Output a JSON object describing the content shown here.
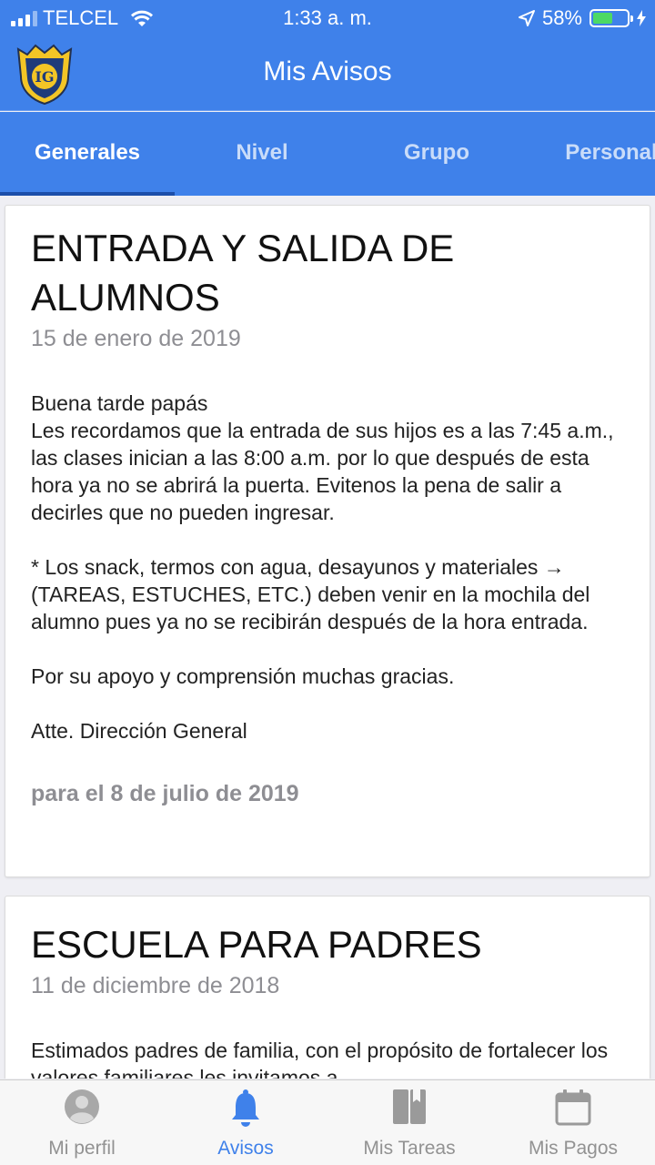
{
  "status": {
    "carrier": "TELCEL",
    "time": "1:33 a. m.",
    "battery": "58%",
    "battery_level": 0.58
  },
  "header": {
    "logo_text": "IG",
    "title": "Mis Avisos"
  },
  "tabs": [
    {
      "label": "Generales",
      "active": true
    },
    {
      "label": "Nivel",
      "active": false
    },
    {
      "label": "Grupo",
      "active": false
    },
    {
      "label": "Personal",
      "active": false
    }
  ],
  "notices": [
    {
      "title": "ENTRADA Y SALIDA DE ALUMNOS",
      "date": "15 de enero de 2019",
      "body": "Buena tarde papás\nLes recordamos que la entrada de sus hijos es a las 7:45 a.m., las clases inician a las 8:00 a.m. por lo que después de esta hora ya no se abrirá la puerta. Evitenos la pena de salir a decirles que no pueden ingresar.\n\n* Los snack, termos con agua, desayunos y materiales → (TAREAS, ESTUCHES, ETC.) deben venir en la mochila del alumno pues ya no se recibirán después de la hora entrada.\n\nPor su apoyo y comprensión muchas gracias.\n\nAtte. Dirección General",
      "valid_until": "para el 8 de julio de 2019"
    },
    {
      "title": "ESCUELA PARA PADRES",
      "date": "11 de diciembre de 2018",
      "body": "Estimados padres de familia, con el propósito de fortalecer los valores familiares les invitamos a"
    }
  ],
  "tabbar": [
    {
      "label": "Mi perfil",
      "icon": "person-icon",
      "active": false
    },
    {
      "label": "Avisos",
      "icon": "bell-icon",
      "active": true
    },
    {
      "label": "Mis Tareas",
      "icon": "book-icon",
      "active": false
    },
    {
      "label": "Mis Pagos",
      "icon": "calendar-icon",
      "active": false
    }
  ],
  "colors": {
    "brand_blue": "#3f81ea",
    "tab_indicator": "#1c4ea9",
    "battery_green": "#4cd964",
    "inactive_gray": "#929292"
  }
}
